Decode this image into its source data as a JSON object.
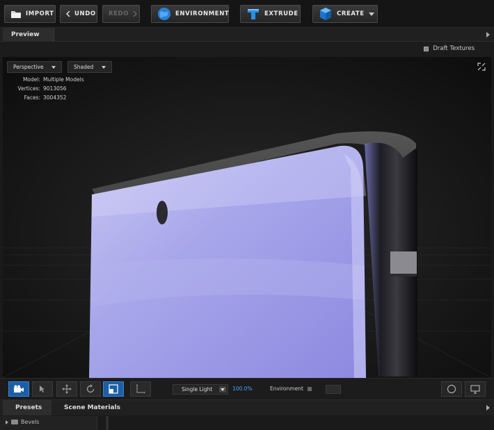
{
  "toolbar": {
    "import_label": "IMPORT",
    "undo_label": "UNDO",
    "redo_label": "REDO",
    "environment_label": "ENVIRONMENT",
    "extrude_label": "EXTRUDE",
    "create_label": "CREATE",
    "colors": {
      "accent": "#2a7fd4",
      "disabled": "#666666"
    }
  },
  "panel": {
    "title": "Preview",
    "draft_textures_label": "Draft Textures"
  },
  "viewport": {
    "camera_mode": "Perspective",
    "shading_mode": "Shaded",
    "stats": [
      {
        "key": "Model:",
        "value": "Multiple Models"
      },
      {
        "key": "Vertices:",
        "value": "9013056"
      },
      {
        "key": "Faces:",
        "value": "3004352"
      }
    ]
  },
  "viewport_tools": {
    "tools": [
      "camera-icon",
      "select-arrow-icon",
      "move-icon",
      "rotate-icon",
      "scale-icon",
      "axis-icon"
    ],
    "active_tool": "camera-icon",
    "light_mode": "Single Light",
    "light_intensity": "100.0%",
    "environment_label": "Environment"
  },
  "bottom_panel": {
    "tabs": [
      "Presets",
      "Scene Materials"
    ],
    "active_tab": "Presets",
    "tree_items": [
      {
        "label": "Bevels"
      }
    ]
  }
}
